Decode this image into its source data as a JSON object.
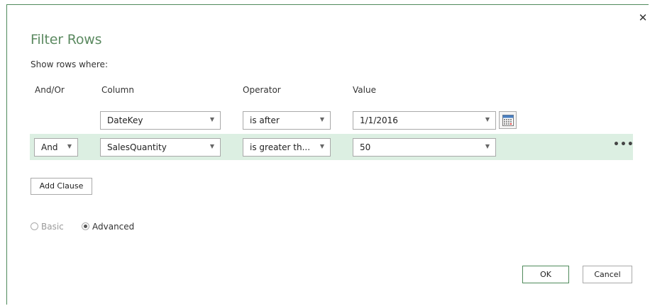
{
  "dialog": {
    "title": "Filter Rows",
    "subtitle": "Show rows where:",
    "close_label": "✕"
  },
  "headers": {
    "and_or": "And/Or",
    "column": "Column",
    "operator": "Operator",
    "value": "Value"
  },
  "clauses": [
    {
      "column": "DateKey",
      "operator": "is after",
      "value": "1/1/2016"
    },
    {
      "and_or": "And",
      "column": "SalesQuantity",
      "operator": "is greater th...",
      "value": "50"
    }
  ],
  "row_menu_label": "•••",
  "add_clause_label": "Add Clause",
  "mode": {
    "basic_label": "Basic",
    "advanced_label": "Advanced",
    "selected": "Advanced"
  },
  "footer": {
    "ok_label": "OK",
    "cancel_label": "Cancel"
  },
  "colors": {
    "title": "#5c8a61",
    "highlight_row": "#dcefe2",
    "border_accent": "#4f8a5b"
  }
}
